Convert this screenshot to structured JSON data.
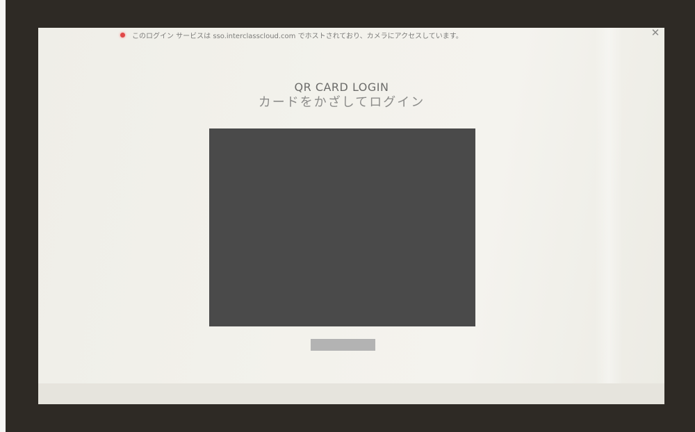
{
  "notice": {
    "text": "このログイン サービスは sso.interclasscloud.com でホストされており、カメラにアクセスしています。",
    "close_label": "✕"
  },
  "login": {
    "title": "QR CARD LOGIN",
    "subtitle": "カードをかざしてログイン"
  },
  "colors": {
    "recording_indicator": "#e04848",
    "camera_area": "#4a4a4a",
    "button": "#b3b3b3"
  }
}
